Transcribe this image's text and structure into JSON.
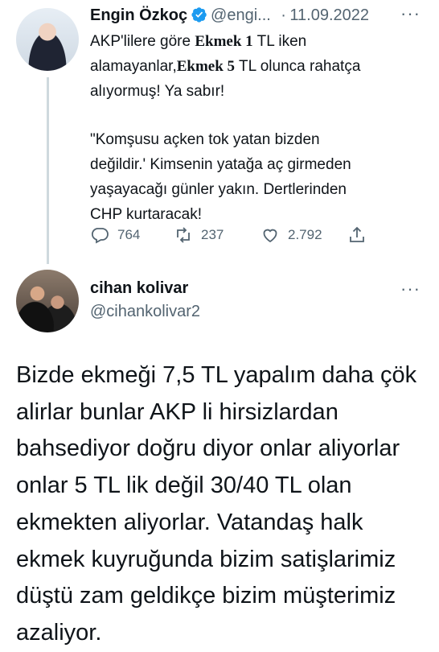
{
  "tweet1": {
    "display_name": "Engin Özkoç",
    "handle": "@engi...",
    "separator": "·",
    "date": "11.09.2022",
    "text_parts": {
      "p1": "AKP'lilere göre ",
      "p2": "Ekmek 1",
      "p3": " TL iken\nalamayanlar,",
      "p4": "Ekmek 5",
      "p5": " TL olunca rahatça\nalıyormuş! Ya sabır!",
      "p6": "\"Komşusu açken tok yatan bizden\ndeğildir.' Kimsenin yatağa aç girmeden\nyaşayacağı günler yakın. Dertlerinden\nCHP kurtaracak!"
    },
    "replies": "764",
    "retweets": "237",
    "likes": "2.792"
  },
  "tweet2": {
    "display_name": "cihan kolivar",
    "handle": "@cihankolivar2",
    "text": "Bizde ekmeği 7,5 TL yapalım daha çök\nalirlar bunlar AKP li hirsizlardan\nbahsediyor doğru diyor onlar aliyorlar\nonlar 5 TL lik değil 30/40 TL olan\nekmekten aliyorlar. Vatandaş halk\nekmek kuyruğunda bizim satişlarimiz\ndüştü zam geldikçe bizim müşterimiz\nazaliyor."
  },
  "icons": {
    "verified": "verified-badge-icon",
    "more": "more-icon",
    "reply": "reply-icon",
    "retweet": "retweet-icon",
    "like": "heart-icon",
    "share": "share-icon"
  },
  "colors": {
    "verified": "#1d9bf0",
    "muted": "#536471",
    "text": "#0f1419"
  }
}
